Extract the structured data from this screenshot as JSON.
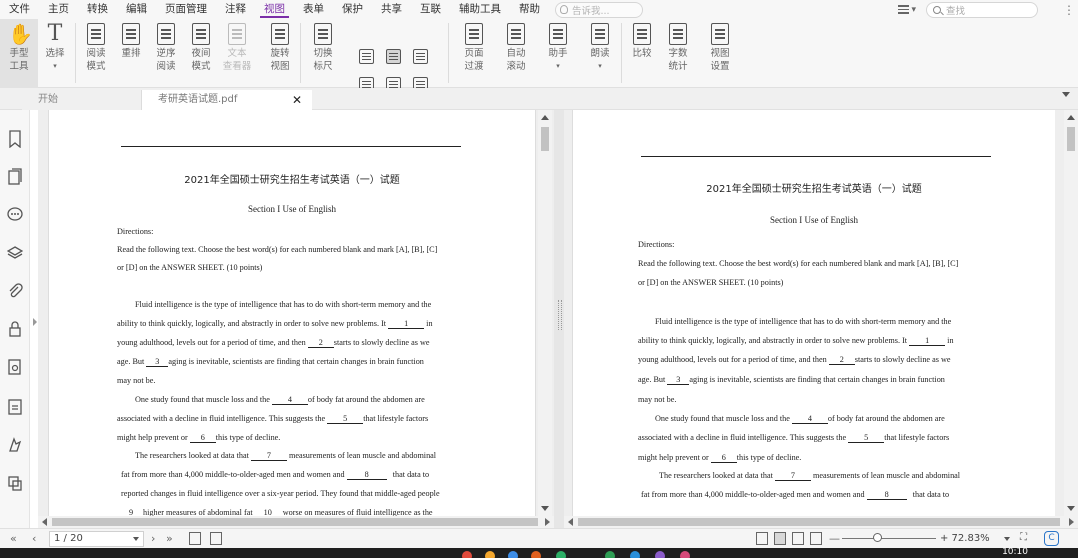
{
  "menubar": {
    "items": [
      "文件",
      "主页",
      "转换",
      "编辑",
      "页面管理",
      "注释",
      "视图",
      "表单",
      "保护",
      "共享",
      "互联",
      "辅助工具",
      "帮助"
    ],
    "active_index": 6,
    "tell_me_placeholder": "告诉我...",
    "search_placeholder": "查找"
  },
  "toolbar": {
    "buttons": [
      {
        "label": "手型\n工具",
        "icon": "hand-icon",
        "state": "active"
      },
      {
        "label": "选择",
        "icon": "select-text-icon",
        "state": "normal"
      },
      {
        "label": "阅读\n模式",
        "icon": "reading-mode-icon",
        "state": "normal"
      },
      {
        "label": "重排",
        "icon": "reflow-icon",
        "state": "normal"
      },
      {
        "label": "逆序\n阅读",
        "icon": "reverse-read-icon",
        "state": "normal"
      },
      {
        "label": "夜间\n模式",
        "icon": "night-mode-icon",
        "state": "normal"
      },
      {
        "label": "文本\n查看器",
        "icon": "text-viewer-icon",
        "state": "disabled"
      },
      {
        "label": "旋转\n视图",
        "icon": "rotate-view-icon",
        "state": "normal"
      },
      {
        "label": "切换\n标尺",
        "icon": "ruler-icon",
        "state": "normal"
      },
      {
        "label": "页面\n过渡",
        "icon": "page-transition-icon",
        "state": "normal"
      },
      {
        "label": "自动\n滚动",
        "icon": "auto-scroll-icon",
        "state": "normal"
      },
      {
        "label": "助手",
        "icon": "assistant-icon",
        "state": "normal"
      },
      {
        "label": "朗读",
        "icon": "read-aloud-icon",
        "state": "normal"
      },
      {
        "label": "比较",
        "icon": "compare-icon",
        "state": "normal"
      },
      {
        "label": "字数\n统计",
        "icon": "word-count-icon",
        "state": "normal"
      },
      {
        "label": "视图\n设置",
        "icon": "view-settings-icon",
        "state": "normal"
      }
    ]
  },
  "tabs": [
    {
      "label": "开始"
    },
    {
      "label": "考研英语试题.pdf"
    }
  ],
  "document": {
    "title": "2021年全国硕士研究生招生考试英语（一）试题",
    "section": "Section I    Use of English",
    "lines": [
      "Directions:",
      "Read the following text. Choose the best word(s) for each numbered blank and mark [A], [B], [C]",
      "or [D] on the ANSWER SHEET. (10 points)",
      "Fluid intelligence is the type of intelligence that has to do with short-term memory and the",
      "ability to think quickly, logically, and abstractly in order to solve new problems. It",
      "in",
      "young adulthood, levels out for a period of time, and then",
      "starts to slowly decline as we",
      "age. But",
      "aging is inevitable, scientists are finding that certain changes in brain function",
      "may not be.",
      "One study found that muscle loss and the",
      "of body fat around the abdomen are",
      "associated with a decline in fluid intelligence. This suggests the",
      "that lifestyle factors",
      "might help prevent or",
      "this type of decline.",
      "The researchers looked at data that",
      "measurements of lean muscle and abdominal",
      "fat from more than 4,000 middle-to-older-aged men and women and",
      "that data to",
      "reported changes in fluid intelligence over a six-year period. They found that middle-aged people",
      "higher measures of abdominal fat",
      "worse on measures of fluid intelligence as the"
    ],
    "blanks": [
      "1",
      "2",
      "3",
      "4",
      "5",
      "6",
      "7",
      "8",
      "9",
      "10"
    ]
  },
  "statusbar": {
    "page_indicator": "1 / 20",
    "zoom": "+ 72.83%",
    "minus": "—"
  },
  "taskbar": {
    "time": "10:10"
  },
  "colors": {
    "accent": "#7b2fa8",
    "badge": "#2a75c9"
  }
}
